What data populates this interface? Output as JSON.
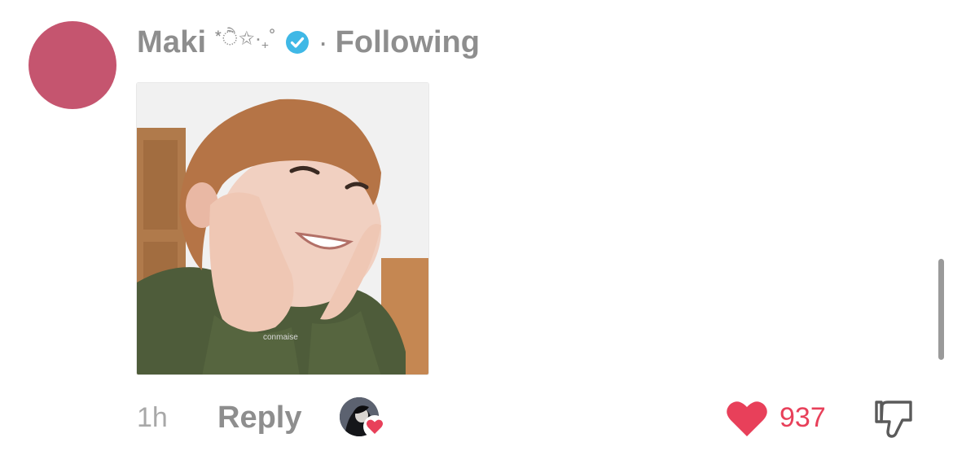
{
  "comment": {
    "username": "Maki",
    "username_decoration": "*ੈ✩‧₊˚",
    "separator": "·",
    "follow_status": "Following",
    "verified_icon": "verified-badge-icon",
    "avatar_color": "#c5556f",
    "media_watermark": "conmaise"
  },
  "footer": {
    "time": "1h",
    "reply_label": "Reply",
    "like_count": "937",
    "like_icon": "heart-icon",
    "dislike_icon": "thumbs-down-icon",
    "creator_liked_icon": "creator-liked-avatar-icon"
  },
  "colors": {
    "accent": "#e8405a",
    "verified": "#3fb8e6",
    "muted_text": "#8e8e8e"
  }
}
